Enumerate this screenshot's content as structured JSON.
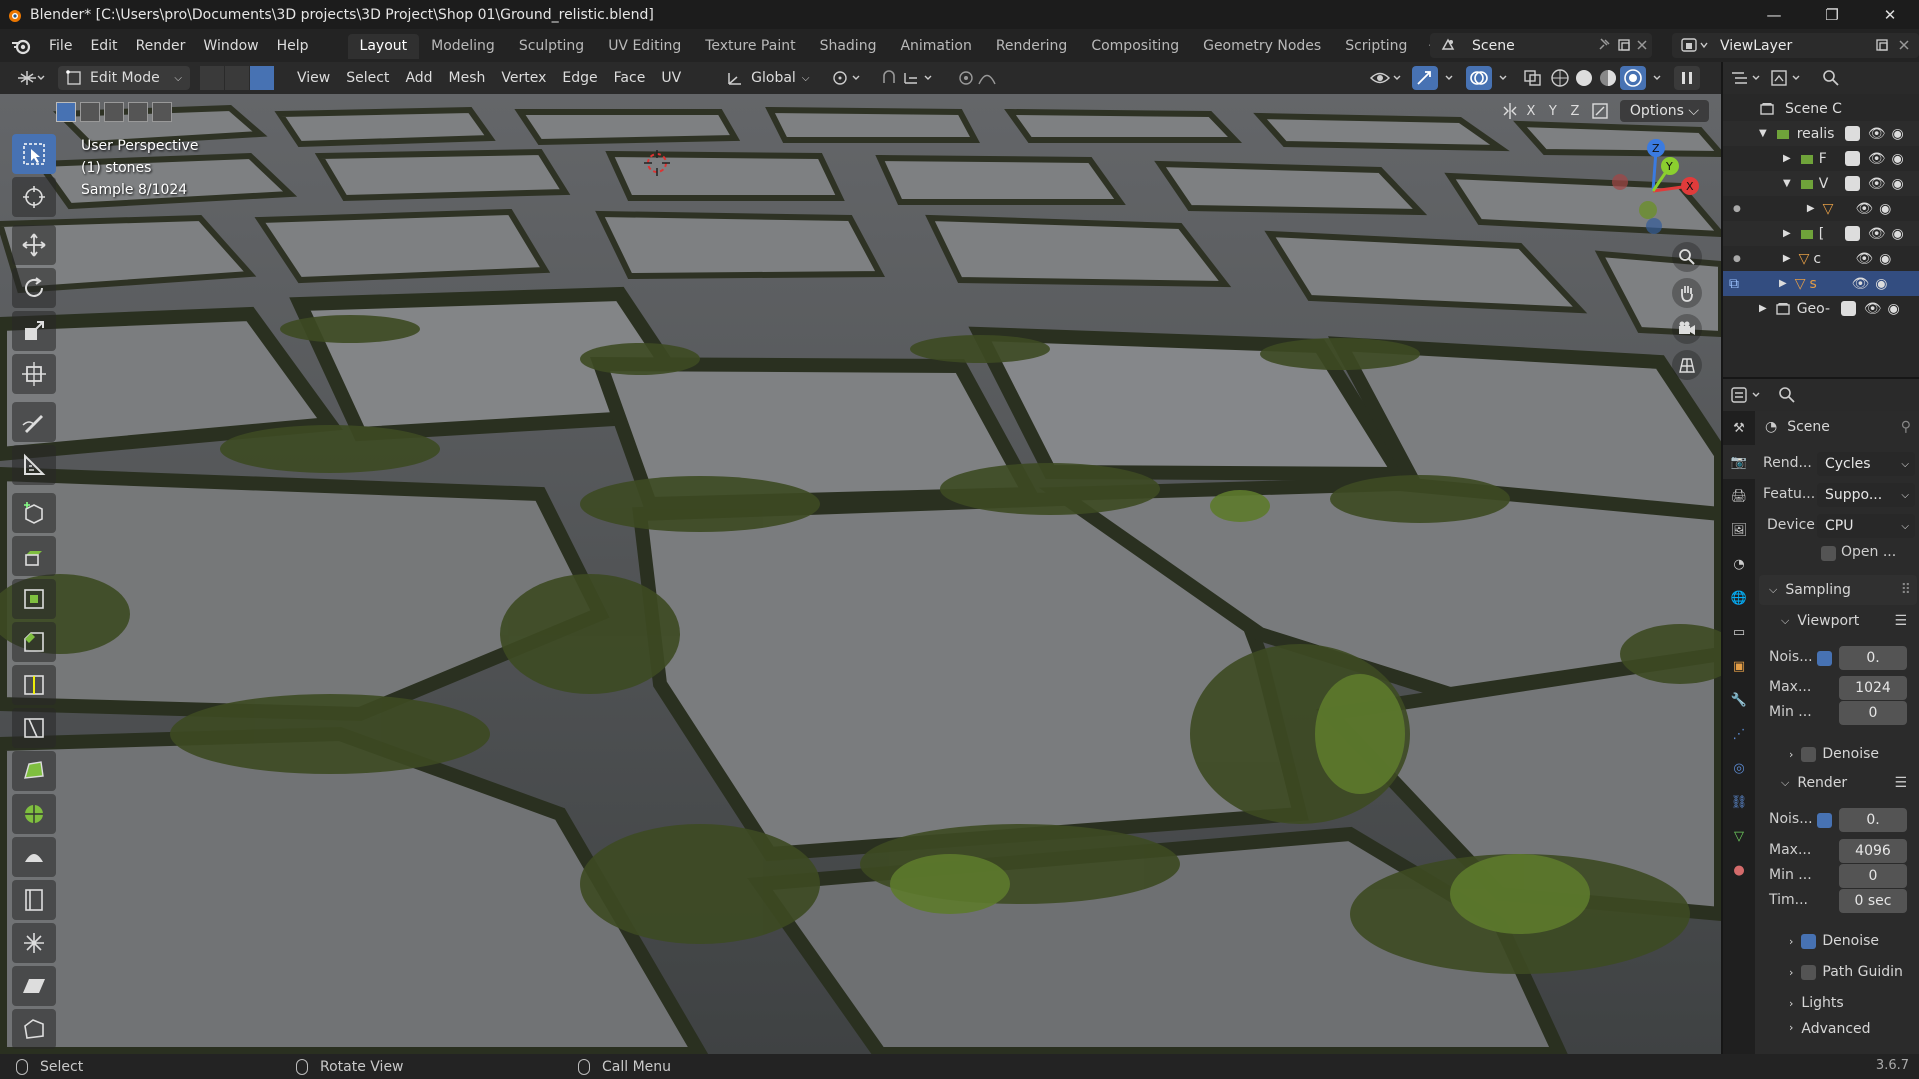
{
  "window": {
    "title": "Blender* [C:\\Users\\pro\\Documents\\3D projects\\3D Project\\Shop 01\\Ground_relistic.blend]",
    "minimize": "—",
    "maximize": "❐",
    "close": "✕"
  },
  "menus": [
    "File",
    "Edit",
    "Render",
    "Window",
    "Help"
  ],
  "workspaces": [
    "Layout",
    "Modeling",
    "Sculpting",
    "UV Editing",
    "Texture Paint",
    "Shading",
    "Animation",
    "Rendering",
    "Compositing",
    "Geometry Nodes",
    "Scripting"
  ],
  "workspace_add": "+",
  "scene_name": "Scene",
  "view_layer": "ViewLayer",
  "viewport_header": {
    "mode": "Edit Mode",
    "menus": [
      "View",
      "Select",
      "Add",
      "Mesh",
      "Vertex",
      "Edge",
      "Face",
      "UV"
    ],
    "orientation": "Global"
  },
  "viewport": {
    "perspective": "User Perspective",
    "object": "(1) stones",
    "sample": "Sample 8/1024",
    "axes": [
      "X",
      "Y",
      "Z"
    ],
    "options": "Options"
  },
  "outliner": {
    "rows": [
      {
        "label": "Scene C"
      },
      {
        "label": "realis"
      },
      {
        "label": "F"
      },
      {
        "label": "V"
      },
      {
        "label": ""
      },
      {
        "label": "["
      },
      {
        "label": "c"
      },
      {
        "label": "s"
      },
      {
        "label": "Geo-"
      }
    ]
  },
  "properties": {
    "header": "Scene",
    "render_engine_label": "Rend...",
    "render_engine": "Cycles",
    "feature_label": "Featu...",
    "feature": "Suppo...",
    "device_label": "Device",
    "device": "CPU",
    "open_label": "Open ...",
    "sampling": "Sampling",
    "viewport_section": "Viewport",
    "vp_noise_label": "Nois...",
    "vp_noise": "0.",
    "vp_max_label": "Max...",
    "vp_max": "1024",
    "vp_min_label": "Min ...",
    "vp_min": "0",
    "vp_denoise": "Denoise",
    "render_section": "Render",
    "r_noise_label": "Nois...",
    "r_noise": "0.",
    "r_max_label": "Max...",
    "r_max": "4096",
    "r_min_label": "Min ...",
    "r_min": "0",
    "r_time_label": "Tim...",
    "r_time": "0 sec",
    "r_denoise": "Denoise",
    "path_guiding": "Path Guidin",
    "lights": "Lights",
    "advanced": "Advanced"
  },
  "statusbar": {
    "select": "Select",
    "rotate": "Rotate View",
    "menu": "Call Menu",
    "version": "3.6.7"
  },
  "colors": {
    "accent": "#4772b3",
    "grass": "#3d4a22",
    "stone": "#7b7d7e"
  }
}
